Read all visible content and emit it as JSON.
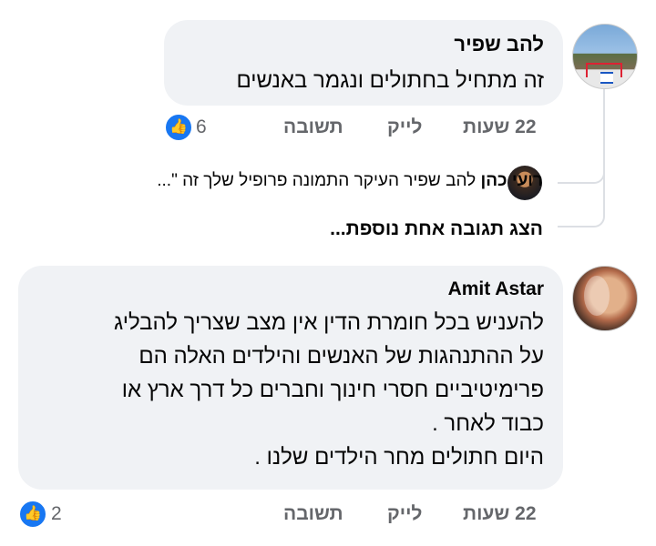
{
  "comment1": {
    "author": "להב שפיר",
    "text": "זה מתחיל בחתולים ונגמר באנשים",
    "time": "22 שעות",
    "like_label": "לייק",
    "reply_label": "תשובה",
    "reaction_count": "6"
  },
  "reply_preview": {
    "author": "רועי כהן",
    "text": "להב שפיר העיקר התמונה פרופיל שלך זה \"..."
  },
  "show_more_replies": "הצג תגובה אחת נוספת...",
  "comment2": {
    "author": "Amit Astar",
    "lines": [
      "להעניש בכל חומרת הדין אין מצב שצריך להבליג",
      "על ההתנהגות של האנשים והילדים האלה הם",
      "פרימיטיביים חסרי חינוך וחברים כל דרך ארץ או",
      "כבוד לאחר .",
      "היום חתולים מחר הילדים שלנו ."
    ],
    "time": "22 שעות",
    "like_label": "לייק",
    "reply_label": "תשובה",
    "reaction_count": "2"
  },
  "colors": {
    "bubble": "#f0f2f5",
    "meta_text": "#65676b",
    "like_blue": "#1877f2",
    "thread_line": "#dcdfe4"
  }
}
